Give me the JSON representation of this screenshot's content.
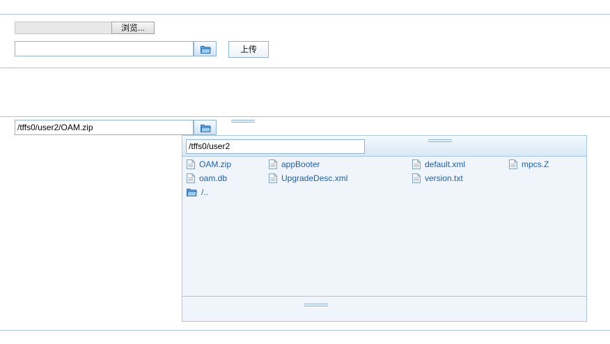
{
  "upload_form": {
    "browse_label": "浏览...",
    "local_path_value": "",
    "upload_label": "上传"
  },
  "download_form": {
    "remote_path_value": "/tffs0/user2/OAM.zip"
  },
  "file_browser": {
    "current_path": "/tffs0/user2",
    "entries": [
      {
        "name": "OAM.zip",
        "type": "file"
      },
      {
        "name": "appBooter",
        "type": "file"
      },
      {
        "name": "default.xml",
        "type": "file"
      },
      {
        "name": "mpcs.Z",
        "type": "file"
      },
      {
        "name": "oam.db",
        "type": "file"
      },
      {
        "name": "UpgradeDesc.xml",
        "type": "file"
      },
      {
        "name": "version.txt",
        "type": "file"
      },
      {
        "name": "/..",
        "type": "folder"
      }
    ]
  },
  "icons": {
    "file": "file-icon",
    "folder": "folder-icon"
  },
  "colors": {
    "border": "#a9c8de",
    "link": "#1f5fa0",
    "panel_bg": "#eff5fb"
  }
}
